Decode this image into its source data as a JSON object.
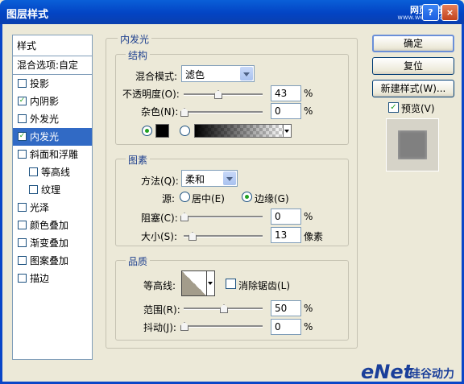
{
  "window": {
    "title": "图层样式",
    "watermark": "网页教学网",
    "watermark_url": "www.webjx.com"
  },
  "sidebar": {
    "header": "样式",
    "blend": "混合选项:自定",
    "items": [
      {
        "label": "投影",
        "checked": false
      },
      {
        "label": "内阴影",
        "checked": true
      },
      {
        "label": "外发光",
        "checked": false
      },
      {
        "label": "内发光",
        "checked": true
      },
      {
        "label": "斜面和浮雕",
        "checked": false
      },
      {
        "label": "等高线",
        "checked": false
      },
      {
        "label": "纹理",
        "checked": false
      },
      {
        "label": "光泽",
        "checked": false
      },
      {
        "label": "颜色叠加",
        "checked": false
      },
      {
        "label": "渐变叠加",
        "checked": false
      },
      {
        "label": "图案叠加",
        "checked": false
      },
      {
        "label": "描边",
        "checked": false
      }
    ]
  },
  "panel": {
    "title": "内发光",
    "structure": {
      "title": "结构",
      "blend_label": "混合模式:",
      "blend_value": "滤色",
      "opacity_label": "不透明度(O):",
      "opacity_value": "43",
      "noise_label": "杂色(N):",
      "noise_value": "0",
      "percent": "%"
    },
    "elements": {
      "title": "图素",
      "method_label": "方法(Q):",
      "method_value": "柔和",
      "source_label": "源:",
      "center_label": "居中(E)",
      "edge_label": "边缘(G)",
      "choke_label": "阻塞(C):",
      "choke_value": "0",
      "size_label": "大小(S):",
      "size_value": "13",
      "percent": "%",
      "px": "像素"
    },
    "quality": {
      "title": "品质",
      "contour_label": "等高线:",
      "antialias_label": "消除锯齿(L)",
      "range_label": "范围(R):",
      "range_value": "50",
      "jitter_label": "抖动(J):",
      "jitter_value": "0",
      "percent": "%"
    }
  },
  "buttons": {
    "ok": "确定",
    "reset": "复位",
    "new_style": "新建样式(W)...",
    "preview": "预览(V)"
  },
  "footer": {
    "brand": "eNet",
    "brand_cn": "硅谷动力"
  },
  "colors": {
    "accent": "#316ac5",
    "titlebar": "#0a5fd8",
    "group_title": "#1d3f8e"
  }
}
